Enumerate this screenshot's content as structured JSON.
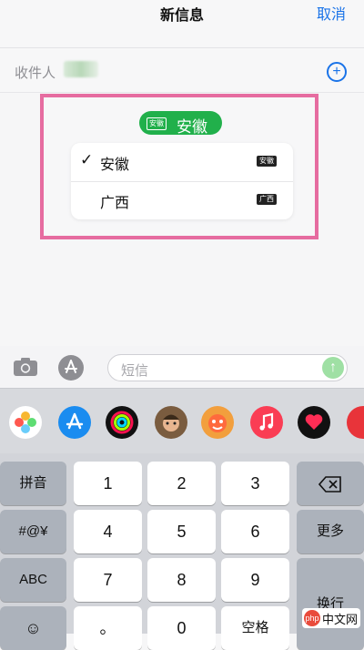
{
  "header": {
    "title": "新信息",
    "cancel_label": "取消"
  },
  "recipient": {
    "label": "收件人",
    "value": "",
    "add_symbol": "+"
  },
  "sim_picker": {
    "selected_badge": "安徽",
    "selected_name": "安徽",
    "options": [
      {
        "check": "✓",
        "label": "安徽",
        "tag": "安徽"
      },
      {
        "check": "",
        "label": "广西",
        "tag": "广西"
      }
    ],
    "highlight_color": "#e66ca0",
    "accent_color": "#21b04b"
  },
  "compose": {
    "placeholder": "短信",
    "send_icon": "arrow-up-icon"
  },
  "app_strip": {
    "apps": [
      "photos-icon",
      "app-store-icon",
      "activity-icon",
      "memoji-icon",
      "animoji-icon",
      "music-icon",
      "digital-touch-icon",
      "more-icon"
    ]
  },
  "keyboard": {
    "left_keys": [
      "拼音",
      "#@¥",
      "ABC",
      "☺"
    ],
    "digits": [
      "1",
      "2",
      "3",
      "4",
      "5",
      "6",
      "7",
      "8",
      "9",
      "。",
      "0"
    ],
    "space_label": "空格",
    "right_keys": [
      "⌫",
      "更多",
      "换行"
    ]
  },
  "watermark": {
    "logo_text": "php",
    "text": "中文网"
  }
}
